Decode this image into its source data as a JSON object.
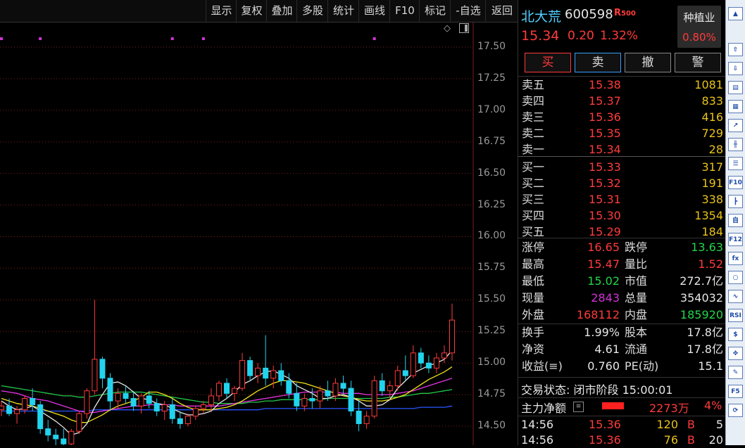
{
  "toolbar": {
    "items": [
      "显示",
      "复权",
      "叠加",
      "多股",
      "统计",
      "画线",
      "F10",
      "标记",
      "-自选",
      "返回"
    ]
  },
  "chart": {
    "y_ticks": [
      "17.50",
      "17.25",
      "17.00",
      "16.75",
      "16.50",
      "16.25",
      "16.00",
      "15.75",
      "15.50",
      "15.25",
      "15.00",
      "14.75",
      "14.50"
    ],
    "colors": {
      "up": "#ff3b3b",
      "down": "#22d3ee",
      "ma5": "#e6e6e6",
      "ma10": "#f2e21a",
      "ma20": "#e534e5",
      "ma30": "#21c94a",
      "ma60": "#2a55ff",
      "grid": "#7a1f1f"
    }
  },
  "chart_data": {
    "type": "candlestick",
    "ylim": [
      14.35,
      17.7
    ],
    "candles": [
      {
        "o": 14.63,
        "h": 14.7,
        "l": 14.58,
        "c": 14.66
      },
      {
        "o": 14.66,
        "h": 14.72,
        "l": 14.58,
        "c": 14.6
      },
      {
        "o": 14.6,
        "h": 14.66,
        "l": 14.52,
        "c": 14.63
      },
      {
        "o": 14.63,
        "h": 14.74,
        "l": 14.6,
        "c": 14.72
      },
      {
        "o": 14.72,
        "h": 14.8,
        "l": 14.62,
        "c": 14.67
      },
      {
        "o": 14.67,
        "h": 14.7,
        "l": 14.44,
        "c": 14.48
      },
      {
        "o": 14.48,
        "h": 14.55,
        "l": 14.38,
        "c": 14.43
      },
      {
        "o": 14.43,
        "h": 14.48,
        "l": 14.34,
        "c": 14.4
      },
      {
        "o": 14.4,
        "h": 14.48,
        "l": 14.32,
        "c": 14.36
      },
      {
        "o": 14.36,
        "h": 14.48,
        "l": 14.33,
        "c": 14.46
      },
      {
        "o": 14.46,
        "h": 14.62,
        "l": 14.44,
        "c": 14.6
      },
      {
        "o": 14.6,
        "h": 14.8,
        "l": 14.56,
        "c": 14.78
      },
      {
        "o": 14.78,
        "h": 15.5,
        "l": 14.75,
        "c": 15.03
      },
      {
        "o": 15.03,
        "h": 15.05,
        "l": 14.8,
        "c": 14.88
      },
      {
        "o": 14.88,
        "h": 14.92,
        "l": 14.62,
        "c": 14.7
      },
      {
        "o": 14.7,
        "h": 14.8,
        "l": 14.64,
        "c": 14.76
      },
      {
        "o": 14.76,
        "h": 14.82,
        "l": 14.68,
        "c": 14.72
      },
      {
        "o": 14.72,
        "h": 14.78,
        "l": 14.62,
        "c": 14.66
      },
      {
        "o": 14.66,
        "h": 14.76,
        "l": 14.6,
        "c": 14.74
      },
      {
        "o": 14.74,
        "h": 14.78,
        "l": 14.64,
        "c": 14.68
      },
      {
        "o": 14.68,
        "h": 14.72,
        "l": 14.58,
        "c": 14.62
      },
      {
        "o": 14.62,
        "h": 14.7,
        "l": 14.55,
        "c": 14.67
      },
      {
        "o": 14.67,
        "h": 14.72,
        "l": 14.52,
        "c": 14.56
      },
      {
        "o": 14.56,
        "h": 14.62,
        "l": 14.48,
        "c": 14.52
      },
      {
        "o": 14.52,
        "h": 14.6,
        "l": 14.5,
        "c": 14.58
      },
      {
        "o": 14.58,
        "h": 14.66,
        "l": 14.55,
        "c": 14.64
      },
      {
        "o": 14.64,
        "h": 14.7,
        "l": 14.6,
        "c": 14.67
      },
      {
        "o": 14.67,
        "h": 14.8,
        "l": 14.62,
        "c": 14.74
      },
      {
        "o": 14.74,
        "h": 14.86,
        "l": 14.7,
        "c": 14.84
      },
      {
        "o": 14.84,
        "h": 14.88,
        "l": 14.72,
        "c": 14.76
      },
      {
        "o": 14.76,
        "h": 14.82,
        "l": 14.7,
        "c": 14.8
      },
      {
        "o": 14.8,
        "h": 15.08,
        "l": 14.78,
        "c": 15.02
      },
      {
        "o": 15.02,
        "h": 15.05,
        "l": 14.86,
        "c": 14.9
      },
      {
        "o": 14.9,
        "h": 15.0,
        "l": 14.84,
        "c": 14.96
      },
      {
        "o": 14.96,
        "h": 15.22,
        "l": 14.82,
        "c": 14.88
      },
      {
        "o": 14.88,
        "h": 14.98,
        "l": 14.8,
        "c": 14.94
      },
      {
        "o": 14.94,
        "h": 15.0,
        "l": 14.82,
        "c": 14.86
      },
      {
        "o": 14.86,
        "h": 14.92,
        "l": 14.72,
        "c": 14.76
      },
      {
        "o": 14.76,
        "h": 14.84,
        "l": 14.62,
        "c": 14.66
      },
      {
        "o": 14.66,
        "h": 14.76,
        "l": 14.62,
        "c": 14.72
      },
      {
        "o": 14.72,
        "h": 14.8,
        "l": 14.64,
        "c": 14.7
      },
      {
        "o": 14.7,
        "h": 14.82,
        "l": 14.64,
        "c": 14.78
      },
      {
        "o": 14.78,
        "h": 14.86,
        "l": 14.7,
        "c": 14.74
      },
      {
        "o": 14.74,
        "h": 14.88,
        "l": 14.7,
        "c": 14.84
      },
      {
        "o": 14.84,
        "h": 14.9,
        "l": 14.76,
        "c": 14.8
      },
      {
        "o": 14.8,
        "h": 14.86,
        "l": 14.58,
        "c": 14.62
      },
      {
        "o": 14.62,
        "h": 14.7,
        "l": 14.46,
        "c": 14.52
      },
      {
        "o": 14.52,
        "h": 14.62,
        "l": 14.48,
        "c": 14.58
      },
      {
        "o": 14.58,
        "h": 14.9,
        "l": 14.56,
        "c": 14.86
      },
      {
        "o": 14.86,
        "h": 14.92,
        "l": 14.74,
        "c": 14.78
      },
      {
        "o": 14.78,
        "h": 14.86,
        "l": 14.72,
        "c": 14.82
      },
      {
        "o": 14.82,
        "h": 14.98,
        "l": 14.78,
        "c": 14.94
      },
      {
        "o": 14.94,
        "h": 15.06,
        "l": 14.86,
        "c": 14.9
      },
      {
        "o": 14.9,
        "h": 15.14,
        "l": 14.88,
        "c": 15.08
      },
      {
        "o": 15.08,
        "h": 15.12,
        "l": 14.96,
        "c": 15.0
      },
      {
        "o": 15.0,
        "h": 15.06,
        "l": 14.92,
        "c": 14.96
      },
      {
        "o": 14.96,
        "h": 15.08,
        "l": 14.92,
        "c": 15.04
      },
      {
        "o": 15.04,
        "h": 15.14,
        "l": 15.0,
        "c": 15.08
      },
      {
        "o": 15.08,
        "h": 15.47,
        "l": 15.02,
        "c": 15.34
      }
    ],
    "ma5": [
      14.7,
      14.66,
      14.63,
      14.64,
      14.66,
      14.62,
      14.58,
      14.54,
      14.49,
      14.43,
      14.45,
      14.52,
      14.65,
      14.75,
      14.84,
      14.85,
      14.82,
      14.77,
      14.72,
      14.71,
      14.68,
      14.67,
      14.64,
      14.61,
      14.59,
      14.59,
      14.6,
      14.62,
      14.68,
      14.72,
      14.77,
      14.83,
      14.86,
      14.9,
      14.93,
      14.94,
      14.91,
      14.88,
      14.82,
      14.79,
      14.76,
      14.72,
      14.72,
      14.74,
      14.75,
      14.73,
      14.7,
      14.66,
      14.66,
      14.67,
      14.71,
      14.8,
      14.86,
      14.92,
      14.95,
      14.98,
      15.0,
      15.03,
      15.1
    ],
    "ma10": [
      14.72,
      14.7,
      14.68,
      14.67,
      14.66,
      14.64,
      14.62,
      14.6,
      14.58,
      14.55,
      14.53,
      14.53,
      14.56,
      14.59,
      14.63,
      14.66,
      14.68,
      14.7,
      14.73,
      14.77,
      14.77,
      14.75,
      14.72,
      14.68,
      14.65,
      14.63,
      14.63,
      14.63,
      14.64,
      14.65,
      14.67,
      14.7,
      14.74,
      14.78,
      14.81,
      14.84,
      14.86,
      14.86,
      14.85,
      14.84,
      14.82,
      14.8,
      14.78,
      14.76,
      14.74,
      14.73,
      14.71,
      14.7,
      14.7,
      14.7,
      14.71,
      14.73,
      14.75,
      14.79,
      14.83,
      14.87,
      14.9,
      14.93,
      14.97
    ],
    "ma20": [
      14.78,
      14.77,
      14.76,
      14.74,
      14.72,
      14.71,
      14.7,
      14.68,
      14.66,
      14.64,
      14.62,
      14.61,
      14.61,
      14.62,
      14.63,
      14.64,
      14.65,
      14.66,
      14.66,
      14.67,
      14.67,
      14.67,
      14.67,
      14.66,
      14.66,
      14.66,
      14.66,
      14.66,
      14.66,
      14.67,
      14.68,
      14.69,
      14.7,
      14.71,
      14.72,
      14.73,
      14.74,
      14.75,
      14.76,
      14.77,
      14.77,
      14.77,
      14.77,
      14.77,
      14.76,
      14.76,
      14.76,
      14.75,
      14.75,
      14.75,
      14.75,
      14.76,
      14.77,
      14.78,
      14.8,
      14.82,
      14.84,
      14.86,
      14.88
    ],
    "ma30": [
      14.82,
      14.81,
      14.8,
      14.79,
      14.78,
      14.77,
      14.76,
      14.75,
      14.74,
      14.74,
      14.73,
      14.73,
      14.74,
      14.75,
      14.76,
      14.77,
      14.77,
      14.77,
      14.77,
      14.76,
      14.75,
      14.74,
      14.73,
      14.72,
      14.71,
      14.7,
      14.69,
      14.69,
      14.68,
      14.68,
      14.68,
      14.68,
      14.69,
      14.69,
      14.7,
      14.7,
      14.71,
      14.71,
      14.71,
      14.71,
      14.71,
      14.71,
      14.72,
      14.72,
      14.72,
      14.72,
      14.72,
      14.72,
      14.72,
      14.72,
      14.73,
      14.73,
      14.74,
      14.75,
      14.76,
      14.76,
      14.77,
      14.78,
      14.79
    ],
    "ma60": [
      14.62,
      14.62,
      14.62,
      14.62,
      14.62,
      14.62,
      14.62,
      14.62,
      14.62,
      14.62,
      14.62,
      14.62,
      14.63,
      14.63,
      14.63,
      14.63,
      14.63,
      14.63,
      14.63,
      14.63,
      14.63,
      14.63,
      14.63,
      14.63,
      14.63,
      14.63,
      14.63,
      14.63,
      14.63,
      14.63,
      14.63,
      14.63,
      14.63,
      14.63,
      14.64,
      14.64,
      14.64,
      14.64,
      14.64,
      14.64,
      14.64,
      14.64,
      14.64,
      14.64,
      14.64,
      14.64,
      14.64,
      14.64,
      14.64,
      14.64,
      14.64,
      14.64,
      14.64,
      14.64,
      14.65,
      14.65,
      14.65,
      14.65,
      14.66
    ],
    "markers": [
      0,
      5,
      22,
      26,
      48
    ]
  },
  "quote": {
    "name": "北大荒",
    "code": "600598",
    "r_badge": "R",
    "r_sub": "500",
    "price": "15.34",
    "change": "0.20",
    "change_pct": "1.32%",
    "industry_label": "种植业",
    "industry_pct": "0.80%",
    "buy_btn": "买",
    "sell_btn": "卖",
    "cancel_btn": "撤",
    "alert_btn": "警"
  },
  "orderbook": {
    "asks": [
      {
        "label": "卖五",
        "price": "15.38",
        "vol": "1081"
      },
      {
        "label": "卖四",
        "price": "15.37",
        "vol": "833"
      },
      {
        "label": "卖三",
        "price": "15.36",
        "vol": "416"
      },
      {
        "label": "卖二",
        "price": "15.35",
        "vol": "729"
      },
      {
        "label": "卖一",
        "price": "15.34",
        "vol": "28"
      }
    ],
    "bids": [
      {
        "label": "买一",
        "price": "15.33",
        "vol": "317"
      },
      {
        "label": "买二",
        "price": "15.32",
        "vol": "191"
      },
      {
        "label": "买三",
        "price": "15.31",
        "vol": "338"
      },
      {
        "label": "买四",
        "price": "15.30",
        "vol": "1354"
      },
      {
        "label": "买五",
        "price": "15.29",
        "vol": "184"
      }
    ]
  },
  "stats": {
    "limit_up_label": "涨停",
    "limit_up": "16.65",
    "limit_down_label": "跌停",
    "limit_down": "13.63",
    "high_label": "最高",
    "high": "15.47",
    "vol_ratio_label": "量比",
    "vol_ratio": "1.52",
    "low_label": "最低",
    "low": "15.02",
    "mcap_label": "市值",
    "mcap": "272.7亿",
    "cur_vol_label": "现量",
    "cur_vol": "2843",
    "total_vol_label": "总量",
    "total_vol": "354032",
    "outer_label": "外盘",
    "outer": "168112",
    "inner_label": "内盘",
    "inner": "185920",
    "turnover_label": "换手",
    "turnover": "1.99%",
    "shares_label": "股本",
    "shares": "17.8亿",
    "nav_label": "净资",
    "nav": "4.61",
    "float_label": "流通",
    "float": "17.8亿",
    "eps_label": "收益(≡)",
    "eps": "0.760",
    "pe_label": "PE(动)",
    "pe": "15.1"
  },
  "status": {
    "trade_state": "交易状态: 闭市阶段 15:00:01",
    "main_flow_label": "主力净额",
    "main_flow": "2273万",
    "main_flow_pct": "4%"
  },
  "ticks": [
    {
      "time": "14:56",
      "price": "15.36",
      "vol": "120",
      "side": "B",
      "count": "5"
    },
    {
      "time": "14:56",
      "price": "15.36",
      "vol": "76",
      "side": "B",
      "count": "20"
    }
  ],
  "sidebar": {
    "icons": [
      "up-arrow",
      "up-hollow-arrow",
      "down-hollow-arrow",
      "report",
      "grid",
      "line-chart",
      "candle",
      "list",
      "F10",
      "tree",
      "self",
      "F12",
      "fx",
      "circle",
      "wave",
      "RSI",
      "dollar",
      "move",
      "pencil",
      "F5",
      "refresh"
    ]
  }
}
